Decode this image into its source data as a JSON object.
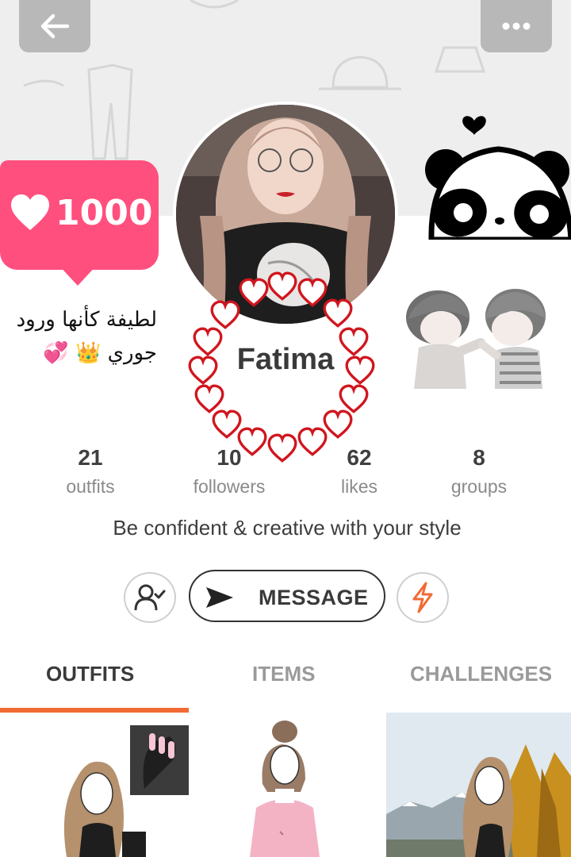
{
  "nav": {
    "back_icon": "arrow-left-icon",
    "more_icon": "more-dots-icon"
  },
  "like_badge": {
    "count": "1000",
    "icon": "heart-icon",
    "color": "#ff4f7e"
  },
  "arabic_note": {
    "line1": "لطيفة كأنها ورود",
    "line2": "جوري 👑 💞"
  },
  "profile": {
    "username": "Fatima",
    "bio": "Be confident & creative with your style"
  },
  "stats": [
    {
      "value": "21",
      "label": "outfits"
    },
    {
      "value": "10",
      "label": "followers"
    },
    {
      "value": "62",
      "label": "likes"
    },
    {
      "value": "8",
      "label": "groups"
    }
  ],
  "actions": {
    "follow_icon": "user-check-icon",
    "message_label": "MESSAGE",
    "message_icon": "send-icon",
    "boost_icon": "lightning-icon"
  },
  "tabs": [
    {
      "label": "OUTFITS",
      "active": true
    },
    {
      "label": "ITEMS",
      "active": false
    },
    {
      "label": "CHALLENGES",
      "active": false
    }
  ],
  "colors": {
    "accent": "#f26b34",
    "header_bg": "#eeeeee",
    "heart_red": "#d0161e"
  }
}
